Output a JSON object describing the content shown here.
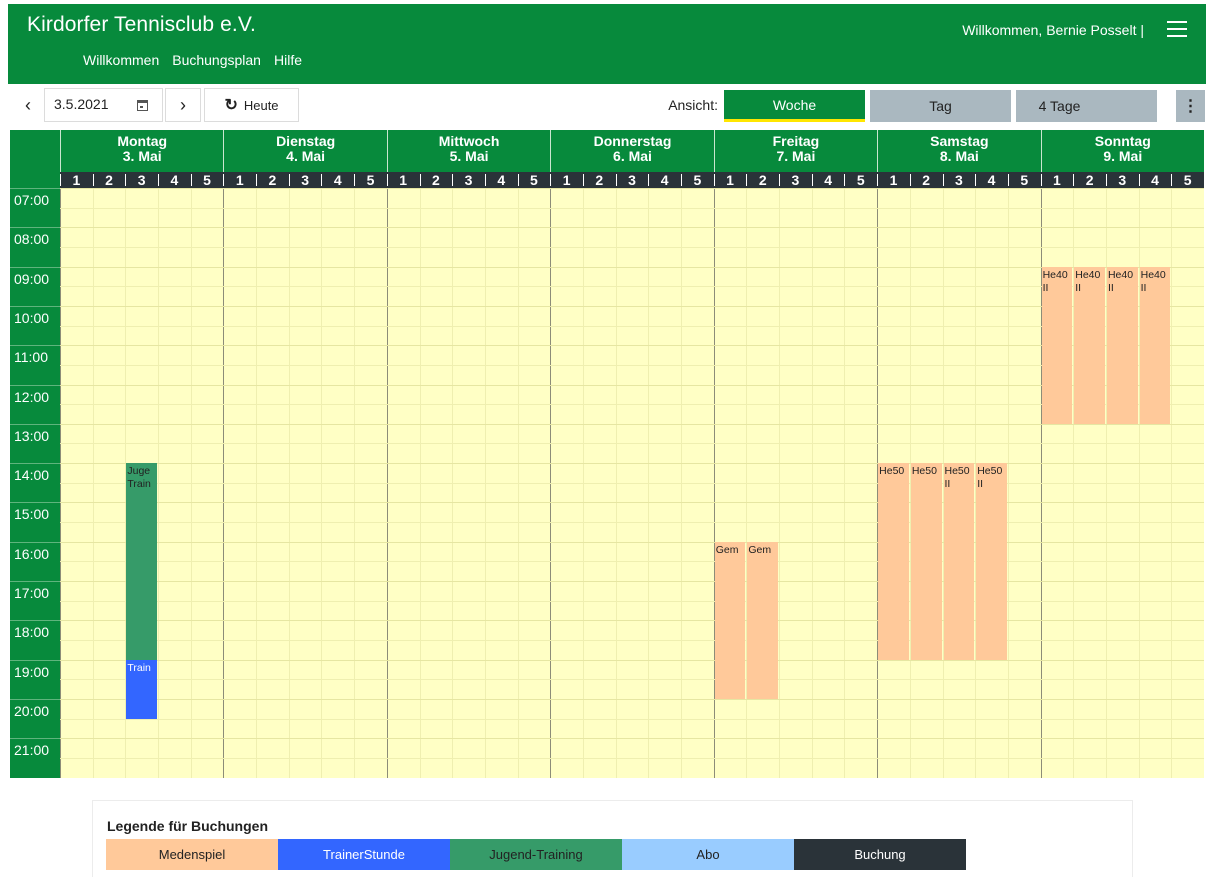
{
  "header": {
    "title": "Kirdorfer Tennisclub e.V.",
    "welcome": "Willkommen, Bernie Posselt  |",
    "nav": [
      "Willkommen",
      "Buchungsplan",
      "Hilfe"
    ]
  },
  "toolbar": {
    "prev": "‹",
    "date": "3.5.2021",
    "next": "›",
    "today_icon": "↻",
    "today": "Heute",
    "ansicht": "Ansicht:",
    "views": [
      "Woche",
      "Tag",
      "4 Tage"
    ],
    "active_view": "Woche",
    "more": "⋮"
  },
  "calendar": {
    "days": [
      {
        "name": "Montag",
        "date": "3. Mai"
      },
      {
        "name": "Dienstag",
        "date": "4. Mai"
      },
      {
        "name": "Mittwoch",
        "date": "5. Mai"
      },
      {
        "name": "Donnerstag",
        "date": "6. Mai"
      },
      {
        "name": "Freitag",
        "date": "7. Mai"
      },
      {
        "name": "Samstag",
        "date": "8. Mai"
      },
      {
        "name": "Sonntag",
        "date": "9. Mai"
      }
    ],
    "courts": [
      "1",
      "2",
      "3",
      "4",
      "5"
    ],
    "hours": [
      "07:00",
      "08:00",
      "09:00",
      "10:00",
      "11:00",
      "12:00",
      "13:00",
      "14:00",
      "15:00",
      "16:00",
      "17:00",
      "18:00",
      "19:00",
      "20:00",
      "21:00"
    ],
    "first_hour": 7,
    "events": [
      {
        "day": 0,
        "court": 3,
        "start": "14:00",
        "end": "19:00",
        "type": "Jugend-Training",
        "text": "Juge\nTrain"
      },
      {
        "day": 0,
        "court": 3,
        "start": "19:00",
        "end": "20:30",
        "type": "TrainerStunde",
        "text": "Train"
      },
      {
        "day": 4,
        "court": 1,
        "start": "16:00",
        "end": "20:00",
        "type": "Medenspiel",
        "text": "Gem"
      },
      {
        "day": 4,
        "court": 2,
        "start": "16:00",
        "end": "20:00",
        "type": "Medenspiel",
        "text": "Gem"
      },
      {
        "day": 5,
        "court": 1,
        "start": "14:00",
        "end": "19:00",
        "type": "Medenspiel",
        "text": "He50"
      },
      {
        "day": 5,
        "court": 2,
        "start": "14:00",
        "end": "19:00",
        "type": "Medenspiel",
        "text": "He50"
      },
      {
        "day": 5,
        "court": 3,
        "start": "14:00",
        "end": "19:00",
        "type": "Medenspiel",
        "text": "He50\nII"
      },
      {
        "day": 5,
        "court": 4,
        "start": "14:00",
        "end": "19:00",
        "type": "Medenspiel",
        "text": "He50\nII"
      },
      {
        "day": 6,
        "court": 1,
        "start": "09:00",
        "end": "13:00",
        "type": "Medenspiel",
        "text": "He40\nII"
      },
      {
        "day": 6,
        "court": 2,
        "start": "09:00",
        "end": "13:00",
        "type": "Medenspiel",
        "text": "He40\nII"
      },
      {
        "day": 6,
        "court": 3,
        "start": "09:00",
        "end": "13:00",
        "type": "Medenspiel",
        "text": "He40\nII"
      },
      {
        "day": 6,
        "court": 4,
        "start": "09:00",
        "end": "13:00",
        "type": "Medenspiel",
        "text": "He40\nII"
      }
    ]
  },
  "legend": {
    "title": "Legende für Buchungen",
    "items": [
      {
        "label": "Medenspiel",
        "color": "#ffc99a",
        "text_color": "#222222"
      },
      {
        "label": "TrainerStunde",
        "color": "#3366ff",
        "text_color": "#ffffff"
      },
      {
        "label": "Jugend-Training",
        "color": "#369b69",
        "text_color": "#222222"
      },
      {
        "label": "Abo",
        "color": "#99ccff",
        "text_color": "#222222"
      },
      {
        "label": "Buchung",
        "color": "#2a3339",
        "text_color": "#ffffff"
      }
    ]
  },
  "colors": {
    "brand": "#078a3c",
    "grid_bg": "#ffffc5",
    "active_underline": "#ffe600"
  }
}
